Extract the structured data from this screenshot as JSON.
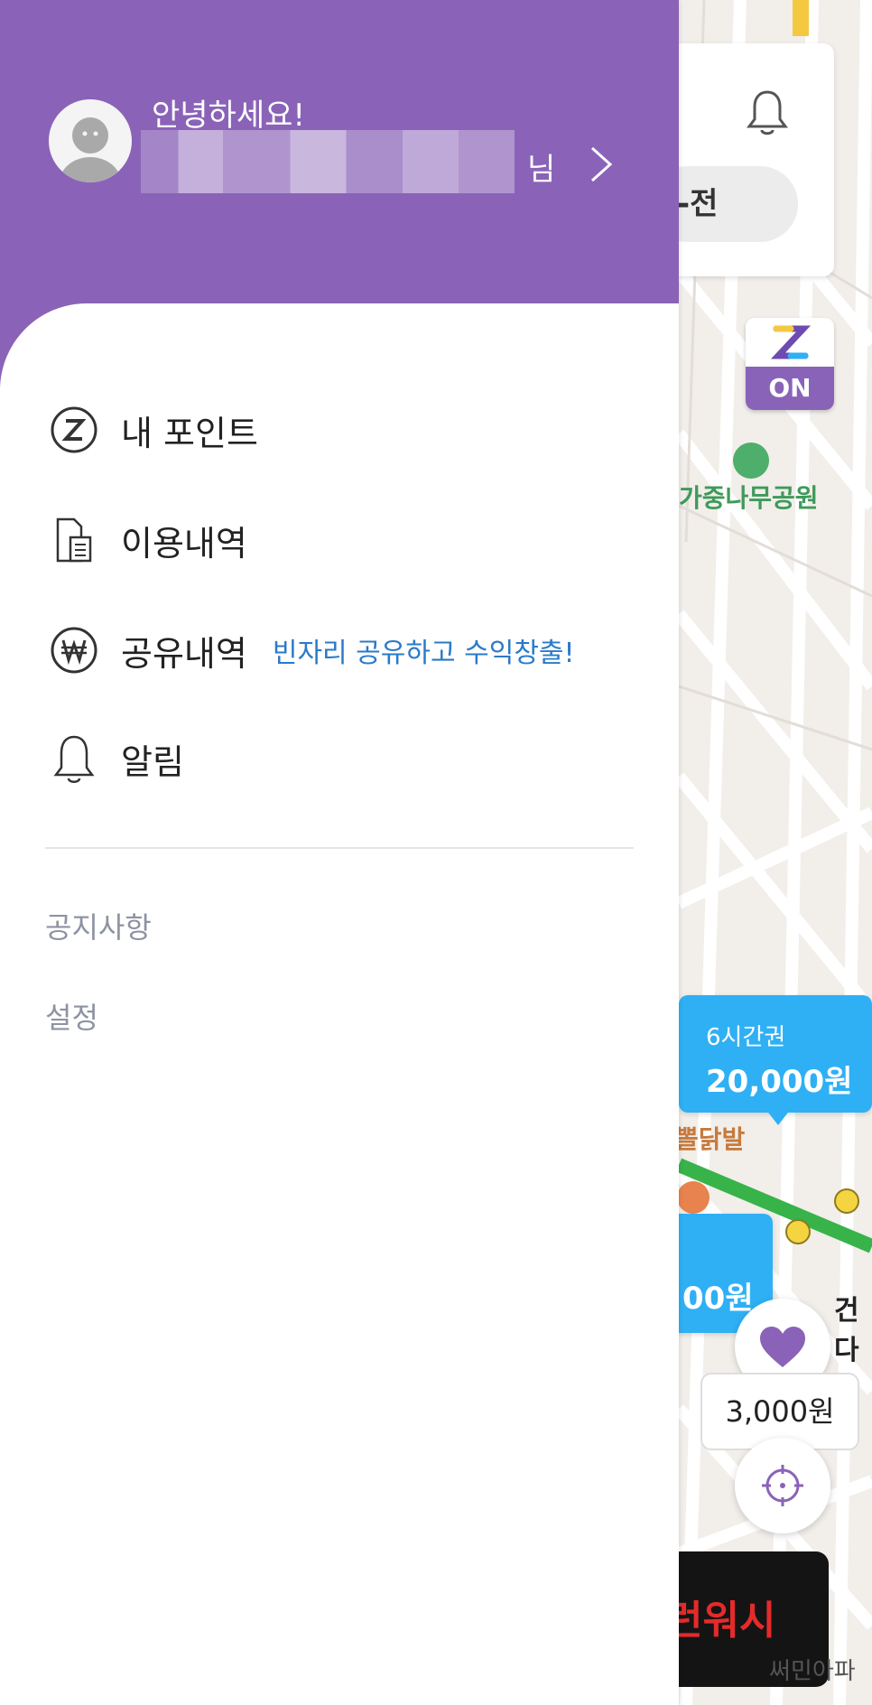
{
  "drawer": {
    "greeting": "안녕하세요!",
    "name_suffix": "님",
    "menu": [
      {
        "label": "내 포인트",
        "icon": "z-point-icon"
      },
      {
        "label": "이용내역",
        "icon": "document-list-icon"
      },
      {
        "label": "공유내역",
        "icon": "won-coin-icon",
        "promo": "빈자리 공유하고 수익창출!"
      },
      {
        "label": "알림",
        "icon": "bell-icon"
      }
    ],
    "links": [
      "공지사항",
      "설정"
    ]
  },
  "map": {
    "search_partial": "-전",
    "zon_badge": "ON",
    "park_label": "가중나무공원",
    "bubble_main": {
      "sub": "6시간권",
      "price": "20,000원"
    },
    "bubble_second": {
      "price": "00원"
    },
    "food_label": "뽈닭발",
    "station_label": "건다",
    "heart_price": "3,000원",
    "ad_text": "런워시",
    "bottom_label": "써민아파"
  },
  "colors": {
    "brand_purple": "#8a63b8",
    "bubble_blue": "#2fb0f5",
    "promo_blue": "#2a7ac9"
  }
}
